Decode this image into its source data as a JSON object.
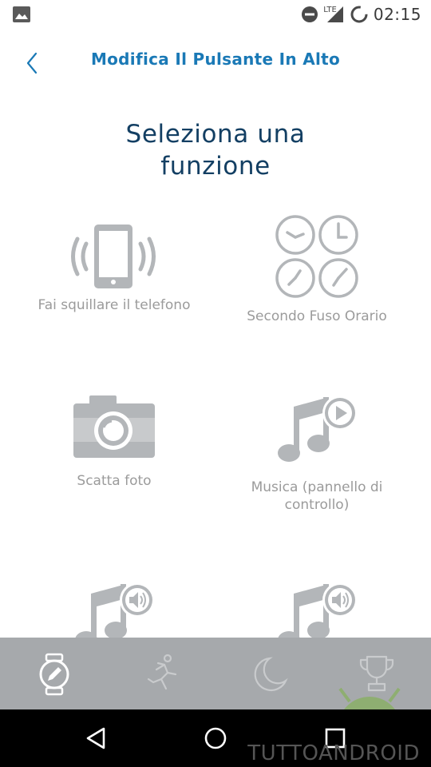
{
  "status_bar": {
    "time": "02:15",
    "network": "LTE",
    "icons": [
      "photo-icon",
      "dnd-icon",
      "signal-icon",
      "sync-icon"
    ]
  },
  "app_bar": {
    "title": "Modifica Il Pulsante In Alto",
    "back_icon": "chevron-left-icon"
  },
  "heading": {
    "line1": "Seleziona una",
    "line2": "funzione"
  },
  "functions": [
    {
      "label": "Fai squillare il telefono",
      "icon": "ring-phone-icon"
    },
    {
      "label": "Secondo Fuso Orario",
      "icon": "second-timezone-icon"
    },
    {
      "label": "Scatta foto",
      "icon": "camera-icon"
    },
    {
      "label": "Musica (pannello di controllo)",
      "icon": "music-control-icon"
    },
    {
      "label": "",
      "icon": "music-volume-icon"
    },
    {
      "label": "",
      "icon": "music-volume-icon"
    }
  ],
  "bottom_tabs": [
    {
      "name": "watch",
      "icon": "watch-edit-icon",
      "active": true
    },
    {
      "name": "activity",
      "icon": "runner-icon",
      "active": false
    },
    {
      "name": "sleep",
      "icon": "moon-icon",
      "active": false
    },
    {
      "name": "goals",
      "icon": "trophy-icon",
      "active": false
    }
  ],
  "nav_bar": {
    "icons": [
      "back-triangle-icon",
      "home-circle-icon",
      "recents-square-icon"
    ]
  },
  "watermark": "TUTTOANDROID",
  "colors": {
    "title_blue": "#1a79b6",
    "heading_navy": "#133f63",
    "icon_grey": "#b3b6b9",
    "label_grey": "#9b9b9b",
    "tabbar_grey": "#a6a9ac"
  }
}
